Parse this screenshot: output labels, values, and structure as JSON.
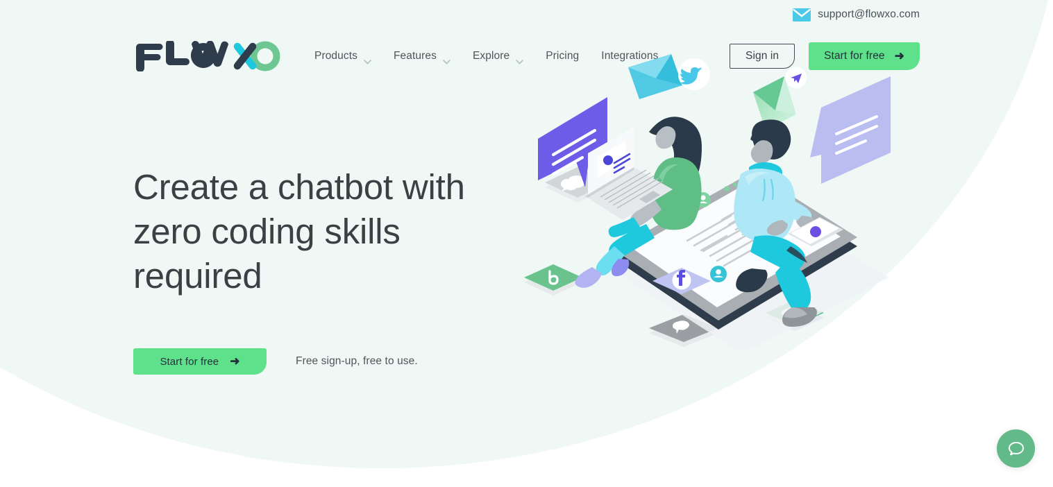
{
  "utility": {
    "mail_icon": "envelope-icon",
    "email": "support@flowxo.com"
  },
  "brand": {
    "logo_text": "FLOWXO",
    "logo_word": "FLOW",
    "logo_x": "X",
    "logo_o": "O",
    "colors": {
      "navy": "#2f3c4c",
      "cyan": "#1ec8dd",
      "green": "#6ec793",
      "mint_bg": "#eff8f4",
      "cta_green": "#5fe08a",
      "text_dark": "#3b4045",
      "text_muted": "#4d555c"
    }
  },
  "nav": {
    "items": [
      {
        "label": "Products",
        "has_caret": true,
        "icon": "chevron-down-icon"
      },
      {
        "label": "Features",
        "has_caret": true,
        "icon": "chevron-down-icon"
      },
      {
        "label": "Explore",
        "has_caret": true,
        "icon": "chevron-down-icon"
      },
      {
        "label": "Pricing",
        "has_caret": false
      },
      {
        "label": "Integrations",
        "has_caret": false
      }
    ]
  },
  "header_actions": {
    "sign_in": "Sign in",
    "start_free": "Start for free",
    "arrow": "➜"
  },
  "hero": {
    "title": "Create a chatbot with zero coding skills required",
    "cta_label": "Start for free",
    "cta_arrow": "➜",
    "note": "Free sign-up, free to use.",
    "illustration_name": "isometric-chatbot-illustration"
  },
  "chat_widget": {
    "icon": "chat-bubble-icon",
    "color": "#62b98a"
  }
}
